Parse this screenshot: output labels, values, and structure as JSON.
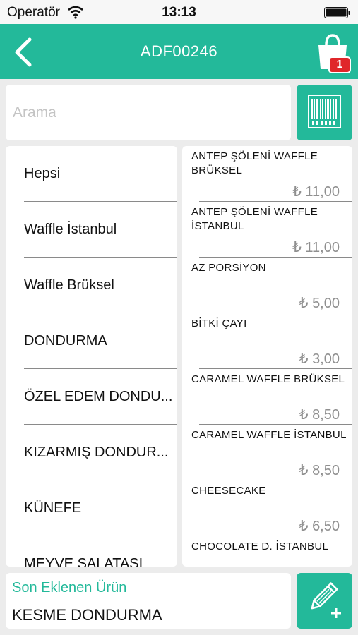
{
  "status_bar": {
    "carrier": "Operatör",
    "time": "13:13"
  },
  "nav": {
    "title": "ADF00246",
    "cart_count": "1"
  },
  "search": {
    "placeholder": "Arama",
    "value": ""
  },
  "categories": [
    {
      "label": "Hepsi"
    },
    {
      "label": "Waffle İstanbul"
    },
    {
      "label": "Waffle Brüksel"
    },
    {
      "label": "DONDURMA"
    },
    {
      "label": "ÖZEL EDEM DONDU..."
    },
    {
      "label": "KIZARMIŞ DONDUR..."
    },
    {
      "label": "KÜNEFE"
    },
    {
      "label": "MEYVE SALATASI"
    }
  ],
  "products": [
    {
      "name": "ANTEP ŞÖLENİ WAFFLE BRÜKSEL",
      "price": "₺ 11,00"
    },
    {
      "name": "ANTEP ŞÖLENİ WAFFLE İSTANBUL",
      "price": "₺ 11,00"
    },
    {
      "name": "AZ PORSİYON",
      "price": "₺ 5,00"
    },
    {
      "name": "BİTKİ ÇAYI",
      "price": "₺ 3,00"
    },
    {
      "name": "CARAMEL WAFFLE BRÜKSEL",
      "price": "₺ 8,50"
    },
    {
      "name": "CARAMEL WAFFLE İSTANBUL",
      "price": "₺ 8,50"
    },
    {
      "name": "CHEESECAKE",
      "price": "₺ 6,50"
    },
    {
      "name": "CHOCOLATE D.  İSTANBUL",
      "price": ""
    }
  ],
  "last_added": {
    "label": "Son Eklenen Ürün",
    "value": "KESME DONDURMA"
  },
  "colors": {
    "accent": "#23b99a",
    "badge": "#e0262a",
    "background": "#ececec",
    "price_text": "#8f8f8f"
  },
  "icons": {
    "back": "chevron-left-icon",
    "cart": "shopping-bag-icon",
    "barcode": "barcode-icon",
    "edit_add": "pencil-plus-icon"
  }
}
